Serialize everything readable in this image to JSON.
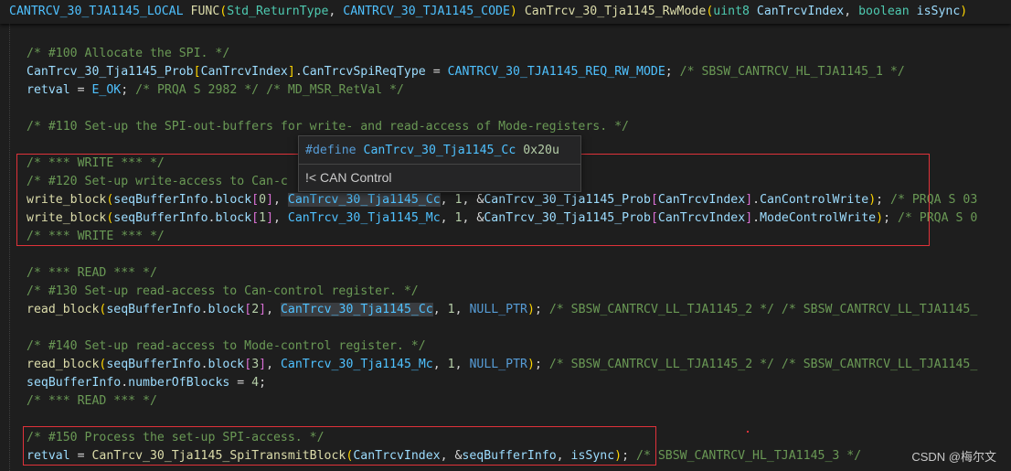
{
  "signature": {
    "macro": "CANTRCV_30_TJA1145_LOCAL",
    "func_kw": "FUNC",
    "ret_type": "Std_ReturnType",
    "code_class": "CANTRCV_30_TJA1145_CODE",
    "func_name": "CanTrcv_30_Tja1145_RwMode",
    "param1_type": "uint8",
    "param1_name": "CanTrcvIndex",
    "param2_type": "boolean",
    "param2_name": "isSync"
  },
  "code": {
    "c100": "/* #100 Allocate the SPI. */",
    "prob": "CanTrcv_30_Tja1145_Prob",
    "idx": "CanTrcvIndex",
    "spi_req_member": "CanTrcvSpiReqType",
    "req_rw_mode": "CANTRCV_30_TJA1145_REQ_RW_MODE",
    "sbsw_hl_1": "/* SBSW_CANTRCV_HL_TJA1145_1 */",
    "retval": "retval",
    "e_ok": "E_OK",
    "prqa_2982": "/* PRQA S 2982 */",
    "md_msr": "/* MD_MSR_RetVal */",
    "c110": "/* #110 Set-up the SPI-out-buffers for write- and read-access of Mode-registers. */",
    "write_start": "/* *** WRITE *** */",
    "c120": "/* #120 Set-up write-access to Can-c",
    "write_block": "write_block",
    "seq": "seqBufferInfo",
    "block": "block",
    "i0": "0",
    "i1": "1",
    "i2": "2",
    "i3": "3",
    "cc": "CanTrcv_30_Tja1145_Cc",
    "mc": "CanTrcv_30_Tja1145_Mc",
    "one": "1",
    "can_ctrl_write": "CanControlWrite",
    "mode_ctrl_write": "ModeControlWrite",
    "prqa_trunc_1": "/* PRQA S 03",
    "prqa_trunc_2": "/* PRQA S 0",
    "write_end": "/* *** WRITE *** */",
    "read_start": "/* *** READ *** */",
    "c130": "/* #130 Set-up read-access to Can-control register. */",
    "read_block": "read_block",
    "null_ptr": "NULL_PTR",
    "sbsw_ll_2": "/* SBSW_CANTRCV_LL_TJA1145_2 */",
    "sbsw_ll_trunc": "/* SBSW_CANTRCV_LL_TJA1145_",
    "c140": "/* #140 Set-up read-access to Mode-control register. */",
    "num_blocks": "numberOfBlocks",
    "four": "4",
    "read_end": "/* *** READ *** */",
    "c150": "/* #150 Process the set-up SPI-access. */",
    "spi_tx": "CanTrcv_30_Tja1145_SpiTransmitBlock",
    "is_sync": "isSync",
    "sbsw_hl_3": "/* SBSW_CANTRCV_HL_TJA1145_3 */"
  },
  "hover": {
    "define_kw": "#define",
    "define_name": "CanTrcv_30_Tja1145_Cc",
    "define_value": "0x20u",
    "doc": "!< CAN Control"
  },
  "watermark": "CSDN @梅尔文",
  "colors": {
    "background": "#1e1e1e",
    "comment": "#6a9955",
    "function": "#dcdcaa",
    "variable": "#9cdcfe",
    "keyword": "#569cd6",
    "macro": "#4fc1ff",
    "annotation_box": "#e0323a"
  }
}
